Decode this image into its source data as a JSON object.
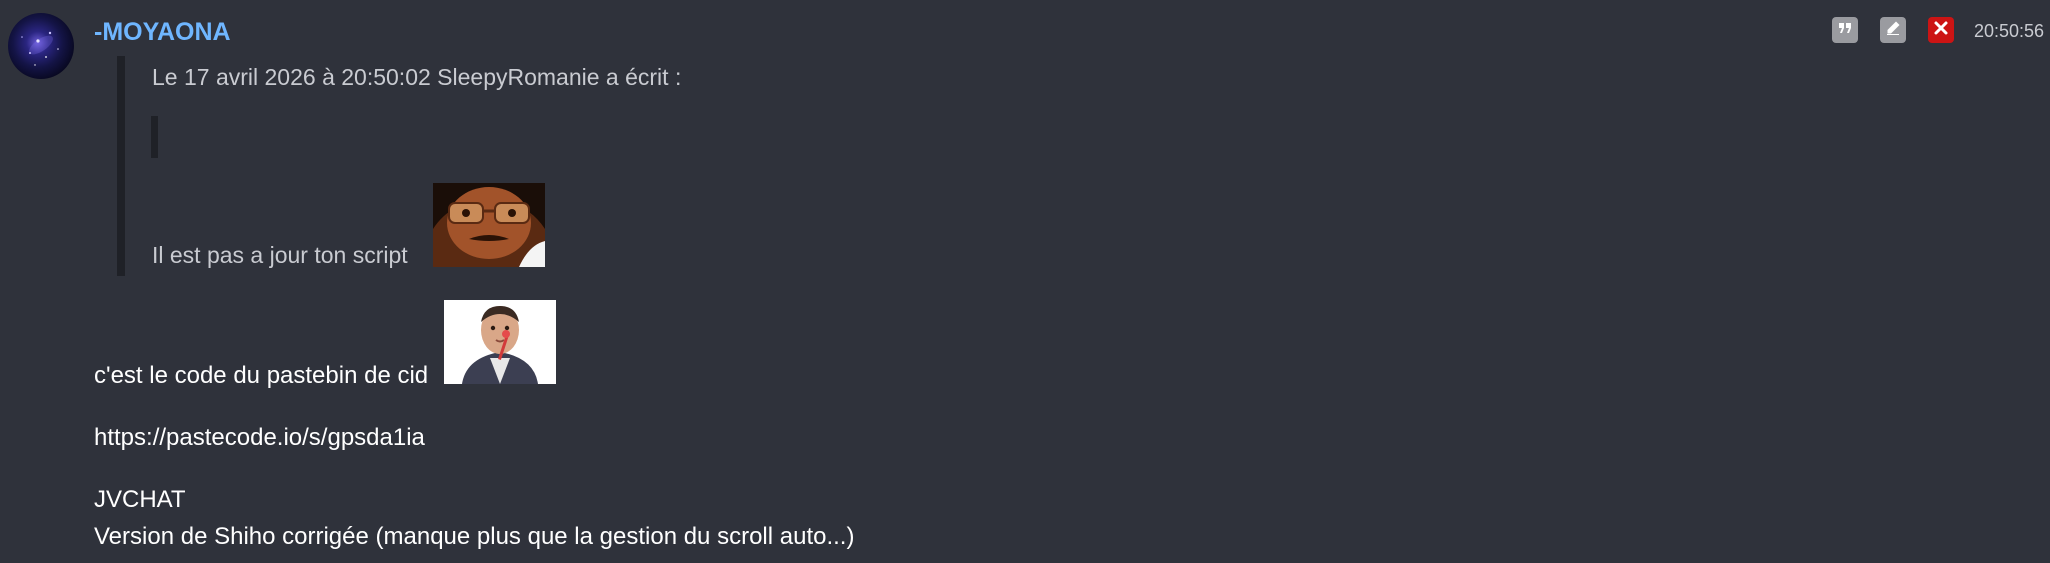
{
  "message": {
    "author": "-MOYAONA",
    "timestamp": "20:50:56",
    "quote": {
      "header": "Le 17 avril 2026 à 20:50:02 SleepyRomanie a écrit :",
      "text": "Il est pas a jour ton script"
    },
    "body": {
      "line1": "c'est le code du pastebin de cid",
      "line2": "https://pastecode.io/s/gpsda1ia",
      "line3": "JVCHAT",
      "line4": "Version de Shiho corrigée (manque plus que la gestion du scroll auto...)"
    }
  },
  "actions": {
    "quote_icon": "quote-icon",
    "edit_icon": "pencil-icon",
    "delete_icon": "close-icon"
  },
  "colors": {
    "background": "#2f323b",
    "author": "#6fb6ff",
    "delete": "#cc1414",
    "action": "#9a9ba0"
  }
}
